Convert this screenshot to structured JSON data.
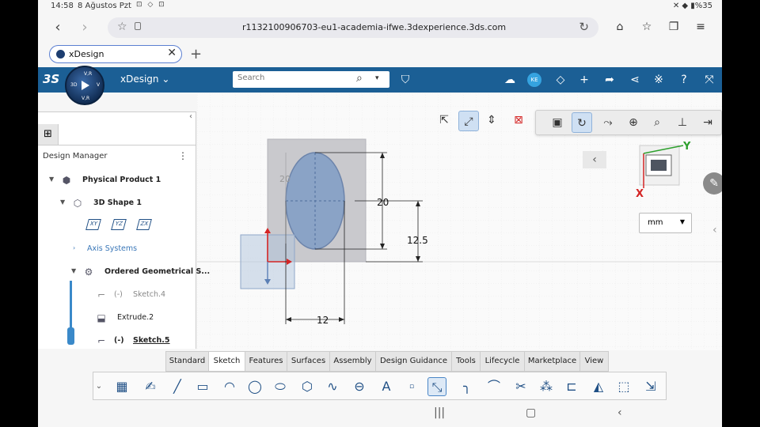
{
  "status": {
    "time": "14:58",
    "date": "8 Ağustos Pzt",
    "icons": "⊡ ◇ ⊡",
    "battery": "%35"
  },
  "browser": {
    "url": "r1132100906703-eu1-academia-ifwe.3dexperience.3ds.com",
    "tab_title": "xDesign",
    "icons": {
      "back": "back-arrow-icon",
      "forward": "forward-arrow-icon",
      "bookmark": "star-icon",
      "reload": "reload-icon",
      "home": "home-icon",
      "bookmarks": "bookmarks-icon",
      "tabs": "tabs-icon",
      "menu": "menu-icon"
    }
  },
  "app": {
    "brand": "3S",
    "compass": {
      "top": "V,R",
      "left": "3D",
      "right": "V",
      "bottom": "V,R"
    },
    "name": "xDesign",
    "search_placeholder": "Search",
    "user_initials": "KE",
    "accent": "#1b5f95"
  },
  "design_manager": {
    "title": "Design Manager",
    "tree": [
      {
        "label": "Physical Product 1",
        "level": 0,
        "expanded": true
      },
      {
        "label": "3D Shape 1",
        "level": 1,
        "expanded": true
      },
      {
        "label": "Axis Systems",
        "level": 2,
        "expanded": false
      },
      {
        "label": "Ordered Geometrical S...",
        "level": 2,
        "expanded": true
      },
      {
        "label": "Sketch.4",
        "prefix": "(-)",
        "level": 3,
        "state": "dimmed"
      },
      {
        "label": "Extrude.2",
        "level": 3,
        "state": "normal"
      },
      {
        "label": "Sketch.5",
        "prefix": "(-)",
        "level": 3,
        "state": "current"
      }
    ],
    "planes": [
      "XY",
      "YZ",
      "ZX"
    ]
  },
  "sketch": {
    "dimensions": {
      "height": "20",
      "offset": "12.5",
      "width": "12",
      "faded": "20"
    },
    "units": "mm",
    "triad": {
      "x": "X",
      "y": "Y"
    }
  },
  "action_bar": {
    "tabs": [
      "Standard",
      "Sketch",
      "Features",
      "Surfaces",
      "Assembly",
      "Design Guidance",
      "Tools",
      "Lifecycle",
      "Marketplace",
      "View"
    ],
    "active_tab": "Sketch"
  }
}
